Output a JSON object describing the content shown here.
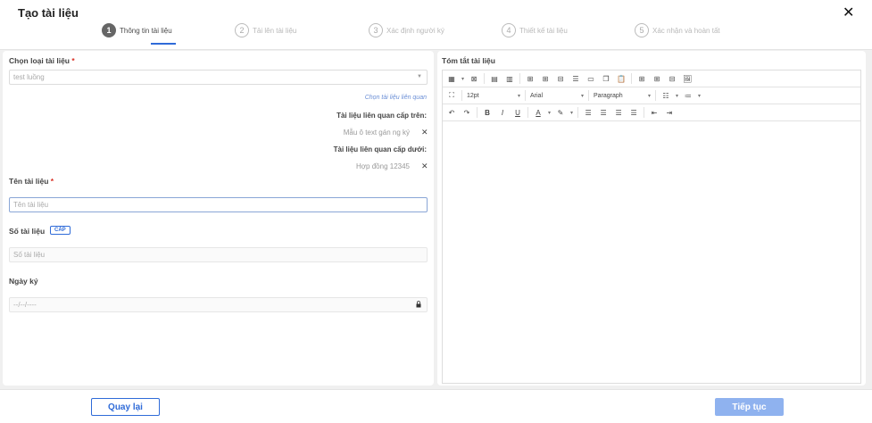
{
  "header": {
    "title": "Tạo tài liệu",
    "steps": [
      {
        "num": "1",
        "label": "Thông tin tài liệu"
      },
      {
        "num": "2",
        "label": "Tải lên tài liệu"
      },
      {
        "num": "3",
        "label": "Xác định người ký"
      },
      {
        "num": "4",
        "label": "Thiết kế tài liệu"
      },
      {
        "num": "5",
        "label": "Xác nhận và hoàn tất"
      }
    ]
  },
  "left": {
    "doc_type": {
      "label": "Chọn loại tài liệu",
      "req": "*",
      "value": "test luồng"
    },
    "related_link": "Chọn tài liệu liên quan",
    "related_upper": {
      "label": "Tài liệu liên quan cấp trên:",
      "item": "Mẫu ô text gán ng ký"
    },
    "related_lower": {
      "label": "Tài liệu liên quan cấp dưới:",
      "item": "Hợp đồng 12345"
    },
    "doc_name": {
      "label": "Tên tài liệu",
      "req": "*",
      "placeholder": "Tên tài liệu"
    },
    "doc_number": {
      "label": "Số tài liệu",
      "badge": "CẤP",
      "placeholder": "Số tài liệu"
    },
    "sign_date": {
      "label": "Ngày ký",
      "placeholder": "--/--/----"
    }
  },
  "right": {
    "summary_label": "Tóm tắt tài liệu",
    "toolbar": {
      "font_size": "12pt",
      "font_family": "Arial",
      "block": "Paragraph"
    }
  },
  "footer": {
    "back": "Quay lại",
    "next": "Tiếp tục"
  },
  "colors": {
    "accent": "#2f6bd8",
    "next_button": "#8fb2ef",
    "required": "#d93025"
  }
}
